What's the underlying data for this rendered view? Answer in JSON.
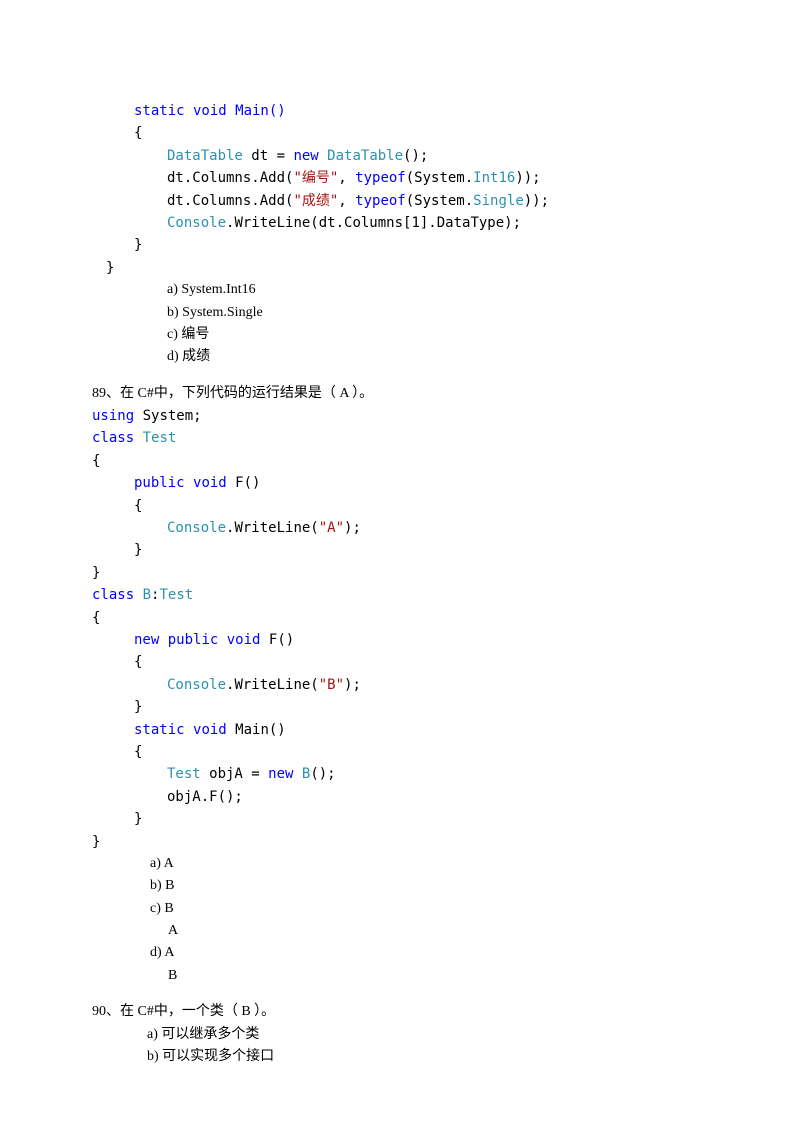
{
  "q88": {
    "code": {
      "l1": "static void Main()",
      "l2": "{",
      "l3a": "DataTable",
      "l3b": " dt = ",
      "l3c": "new",
      "l3d": " ",
      "l3e": "DataTable",
      "l3f": "();",
      "l4a": "dt.Columns.Add(",
      "l4b": "\"编号\"",
      "l4c": ", ",
      "l4d": "typeof",
      "l4e": "(System.",
      "l4f": "Int16",
      "l4g": "));",
      "l5a": "dt.Columns.Add(",
      "l5b": "\"成绩\"",
      "l5c": ", ",
      "l5d": "typeof",
      "l5e": "(System.",
      "l5f": "Single",
      "l5g": "));",
      "l6a": "Console",
      "l6b": ".WriteLine(dt.Columns[1].DataType);",
      "l7": "}",
      "l8": "}"
    },
    "options": {
      "a": "a)   System.Int16",
      "b": "b)   System.Single",
      "c": "c)   编号",
      "d": "d)   成绩"
    }
  },
  "q89": {
    "prompt": "89、在 C#中，下列代码的运行结果是（  A  ）。",
    "code": {
      "l1a": "using",
      "l1b": " System;",
      "l2a": "class",
      "l2b": " ",
      "l2c": "Test",
      "l3": "{",
      "l4a": "public",
      "l4b": " ",
      "l4c": "void",
      "l4d": " F()",
      "l5": "{",
      "l6a": "Console",
      "l6b": ".WriteLine(",
      "l6c": "\"A\"",
      "l6d": ");",
      "l7": "}",
      "l8": "}",
      "l9a": "class",
      "l9b": " ",
      "l9c": "B",
      "l9d": ":",
      "l9e": "Test",
      "l10": "{",
      "l11a": "new",
      "l11b": " ",
      "l11c": "public",
      "l11d": " ",
      "l11e": "void",
      "l11f": " F()",
      "l12": "{",
      "l13a": "Console",
      "l13b": ".WriteLine(",
      "l13c": "\"B\"",
      "l13d": ");",
      "l14": "}",
      "l15a": "static",
      "l15b": " ",
      "l15c": "void",
      "l15d": " Main()",
      "l16": "{",
      "l17a": "Test",
      "l17b": " objA = ",
      "l17c": "new",
      "l17d": " ",
      "l17e": "B",
      "l17f": "();",
      "l18": "objA.F();",
      "l19": "}",
      "l20": "}"
    },
    "options": {
      "a": "a) A",
      "b": "b) B",
      "c": "c) B",
      "c2": "A",
      "d": "d) A",
      "d2": "B"
    }
  },
  "q90": {
    "prompt": "90、在 C#中，一个类（  B  ）。",
    "options": {
      "a": "a)  可以继承多个类",
      "b": "b)  可以实现多个接口"
    }
  }
}
